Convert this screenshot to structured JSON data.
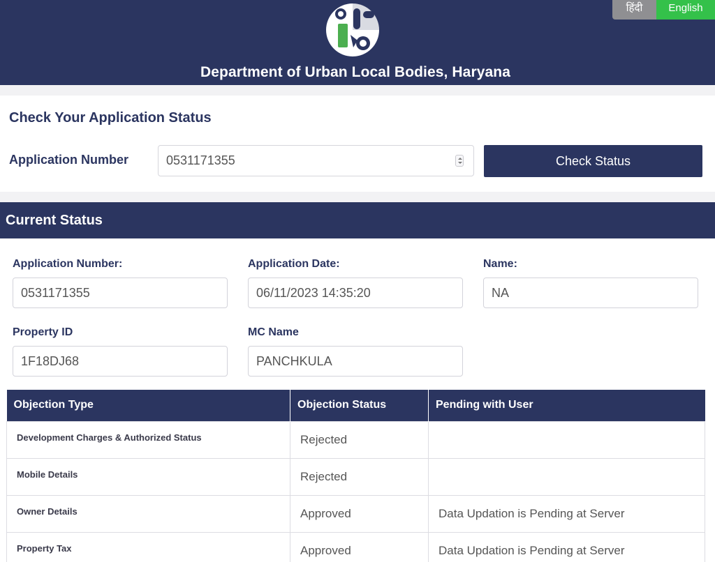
{
  "header": {
    "department_title": "Department of Urban Local Bodies, Haryana",
    "lang_hindi": "हिंदी",
    "lang_english": "English"
  },
  "check": {
    "title": "Check Your Application Status",
    "application_label": "Application Number",
    "application_value": "0531171355",
    "button_label": "Check Status"
  },
  "current_status": {
    "title": "Current Status",
    "fields": {
      "application_number_label": "Application Number:",
      "application_number_value": "0531171355",
      "application_date_label": "Application Date:",
      "application_date_value": "06/11/2023 14:35:20",
      "name_label": "Name:",
      "name_value": "NA",
      "property_id_label": "Property ID",
      "property_id_value": "1F18DJ68",
      "mc_name_label": "MC Name",
      "mc_name_value": "PANCHKULA"
    },
    "table": {
      "headers": [
        "Objection Type",
        "Objection Status",
        "Pending with User"
      ],
      "rows": [
        [
          "Development Charges & Authorized Status",
          "Rejected",
          ""
        ],
        [
          "Mobile Details",
          "Rejected",
          ""
        ],
        [
          "Owner Details",
          "Approved",
          "Data Updation is Pending at Server"
        ],
        [
          "Property Tax",
          "Approved",
          "Data Updation is Pending at Server"
        ]
      ]
    }
  },
  "colors": {
    "navy": "#2b3560",
    "green": "#34c14a",
    "grey": "#8f8f92"
  }
}
